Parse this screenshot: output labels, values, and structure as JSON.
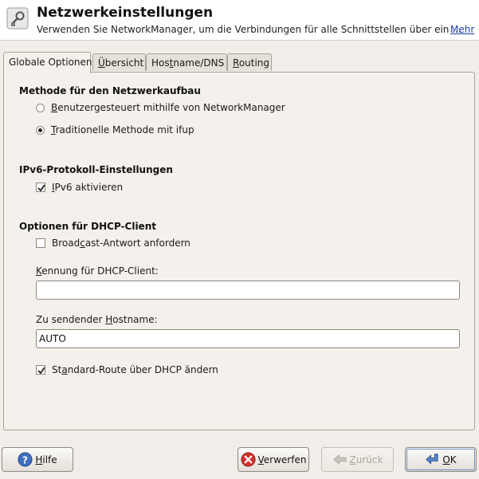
{
  "header": {
    "title": "Netzwerkeinstellungen",
    "subtitle": "Verwenden Sie NetworkManager, um die Verbindungen für alle Schnittstellen über ein ...",
    "more_link": "Mehr",
    "icon": "network-settings-icon"
  },
  "tabs": [
    {
      "label": "Globale Optionen",
      "active": true
    },
    {
      "label_pre": "",
      "label_u": "Ü",
      "label_post": "bersicht",
      "active": false
    },
    {
      "label_pre": "Hos",
      "label_u": "t",
      "label_post": "name/DNS",
      "active": false
    },
    {
      "label_pre": "",
      "label_u": "R",
      "label_post": "outing",
      "active": false
    }
  ],
  "sections": {
    "method": {
      "title": "Methode für den Netzwerkaufbau",
      "options": [
        {
          "pre": "",
          "u": "B",
          "post": "enutzergesteuert mithilfe von NetworkManager",
          "selected": false
        },
        {
          "pre": "",
          "u": "T",
          "post": "raditionelle Methode mit ifup",
          "selected": true
        }
      ]
    },
    "ipv6": {
      "title": "IPv6-Protokoll-Einstellungen",
      "checkbox": {
        "pre": "",
        "u": "I",
        "post": "Pv6 aktivieren",
        "checked": true
      }
    },
    "dhcp": {
      "title": "Optionen für DHCP-Client",
      "broadcast": {
        "pre": "Broad",
        "u": "c",
        "post": "ast-Antwort anfordern",
        "checked": false
      },
      "client_id": {
        "pre": "",
        "u": "K",
        "post": "ennung für DHCP-Client:",
        "value": ""
      },
      "hostname": {
        "pre": "Zu sendender ",
        "u": "H",
        "post": "ostname:",
        "value": "AUTO"
      },
      "default_route": {
        "pre": "St",
        "u": "a",
        "post": "ndard-Route über DHCP ändern",
        "checked": true
      }
    }
  },
  "buttons": {
    "help": {
      "pre": "",
      "u": "H",
      "post": "ilfe",
      "icon": "help-icon"
    },
    "discard": {
      "pre": "",
      "u": "V",
      "post": "erwerfen",
      "icon": "cancel-icon"
    },
    "back": {
      "pre": "",
      "u": "Z",
      "post": "urück",
      "icon": "back-arrow-icon",
      "disabled": true
    },
    "ok": {
      "pre": "",
      "u": "O",
      "post": "K",
      "icon": "ok-arrow-icon"
    }
  }
}
